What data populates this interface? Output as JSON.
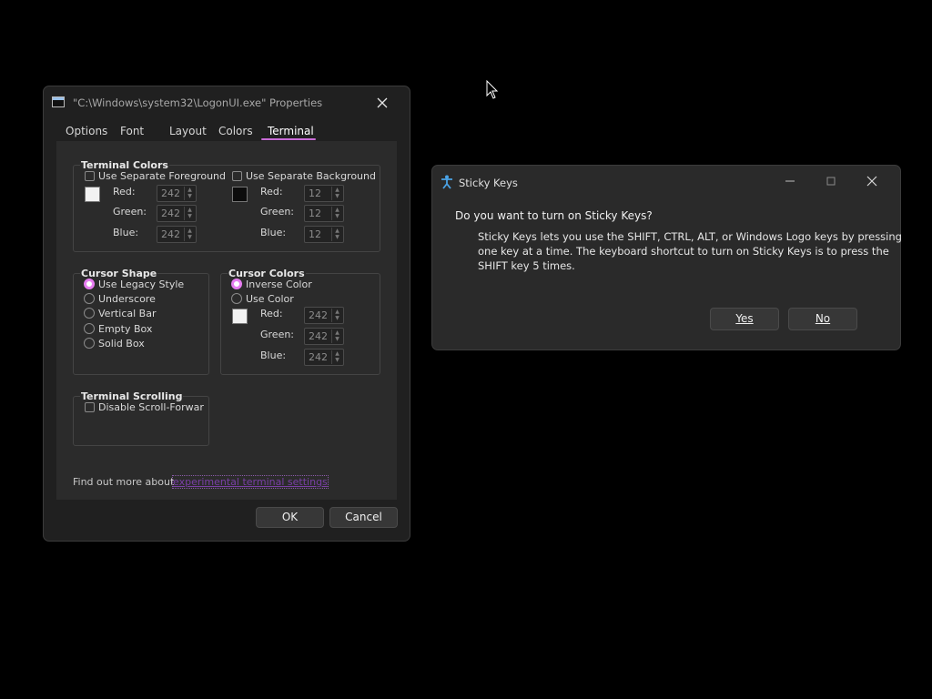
{
  "properties_dialog": {
    "title": "\"C:\\Windows\\system32\\LogonUI.exe\" Properties",
    "tabs": [
      {
        "label": "Options"
      },
      {
        "label": "Font"
      },
      {
        "label": "Layout"
      },
      {
        "label": "Colors"
      },
      {
        "label": "Terminal",
        "active": true
      }
    ],
    "accent_color": "#c86bd6",
    "terminal_colors": {
      "title": "Terminal Colors",
      "foreground": {
        "label": "Use Separate Foreground",
        "checked": false,
        "swatch_color": "#f2f2f2",
        "red_label": "Red:",
        "red": "242",
        "green_label": "Green:",
        "green": "242",
        "blue_label": "Blue:",
        "blue": "242"
      },
      "background": {
        "label": "Use Separate Background",
        "checked": false,
        "swatch_color": "#0c0c0c",
        "red_label": "Red:",
        "red": "12",
        "green_label": "Green:",
        "green": "12",
        "blue_label": "Blue:",
        "blue": "12"
      }
    },
    "cursor_shape": {
      "title": "Cursor Shape",
      "options": [
        {
          "label": "Use Legacy Style",
          "selected": true
        },
        {
          "label": "Underscore",
          "selected": false
        },
        {
          "label": "Vertical Bar",
          "selected": false
        },
        {
          "label": "Empty Box",
          "selected": false
        },
        {
          "label": "Solid Box",
          "selected": false
        }
      ]
    },
    "cursor_colors": {
      "title": "Cursor Colors",
      "options": [
        {
          "label": "Inverse Color",
          "selected": true
        },
        {
          "label": "Use Color",
          "selected": false
        }
      ],
      "swatch_color": "#f2f2f2",
      "red_label": "Red:",
      "red": "242",
      "green_label": "Green:",
      "green": "242",
      "blue_label": "Blue:",
      "blue": "242"
    },
    "terminal_scrolling": {
      "title": "Terminal Scrolling",
      "checkbox_label": "Disable Scroll-Forwar",
      "checked": false
    },
    "find_more_text": "Find out more about",
    "find_more_link": "experimental terminal settings",
    "ok_label": "OK",
    "cancel_label": "Cancel",
    "close_icon": "close-icon"
  },
  "sticky_keys_dialog": {
    "title": "Sticky Keys",
    "app_icon": "accessibility-icon",
    "question": "Do you want to turn on Sticky Keys?",
    "description_lines": [
      "Sticky Keys lets you use the SHIFT, CTRL, ALT, or Windows Logo keys by pressing",
      "one key at a time. The keyboard shortcut to turn on Sticky Keys is to press the",
      "SHIFT key 5 times."
    ],
    "yes_label": "Yes",
    "no_label": "No",
    "caption_buttons": [
      "minimize-icon",
      "maximize-icon",
      "close-icon"
    ]
  }
}
